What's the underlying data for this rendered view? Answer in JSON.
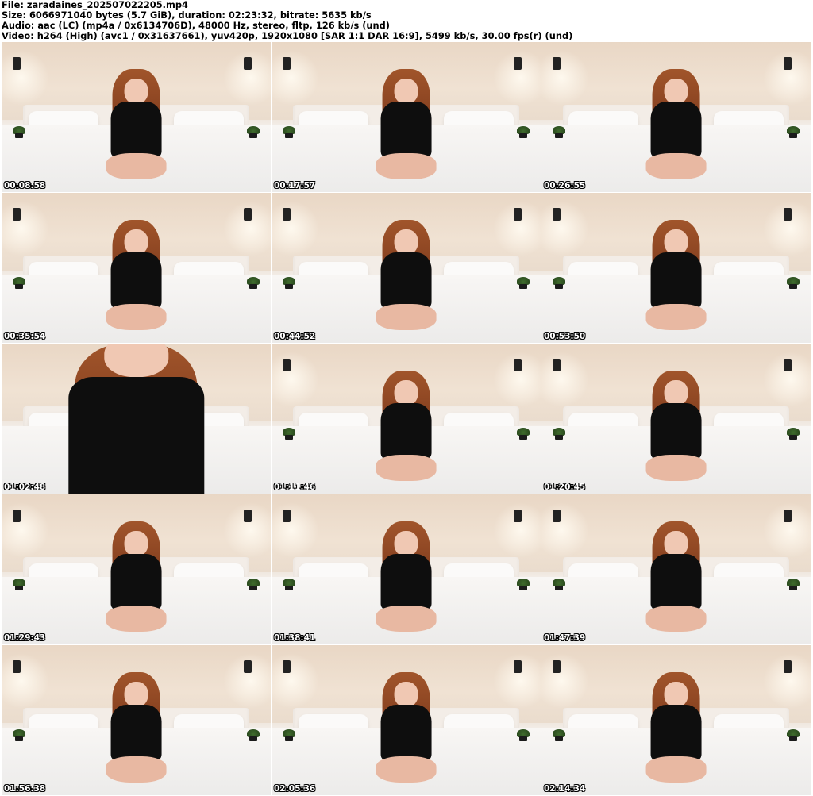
{
  "header": {
    "line1": "File: zaradaines_202507022205.mp4",
    "line2": "Size: 6066971040 bytes (5.7 GiB), duration: 02:23:32, bitrate: 5635 kb/s",
    "line3": "Audio: aac (LC) (mp4a / 0x6134706D), 48000 Hz, stereo, fltp, 126 kb/s (und)",
    "line4": "Video: h264 (High) (avc1 / 0x31637661), yuv420p, 1920x1080 [SAR 1:1 DAR 16:9], 5499 kb/s, 30.00 fps(r) (und)"
  },
  "thumbnails": [
    {
      "timestamp": "00:08:58"
    },
    {
      "timestamp": "00:17:57"
    },
    {
      "timestamp": "00:26:55"
    },
    {
      "timestamp": "00:35:54"
    },
    {
      "timestamp": "00:44:52"
    },
    {
      "timestamp": "00:53:50"
    },
    {
      "timestamp": "01:02:48"
    },
    {
      "timestamp": "01:11:46"
    },
    {
      "timestamp": "01:20:45"
    },
    {
      "timestamp": "01:29:43"
    },
    {
      "timestamp": "01:38:41"
    },
    {
      "timestamp": "01:47:39"
    },
    {
      "timestamp": "01:56:38"
    },
    {
      "timestamp": "02:05:36"
    },
    {
      "timestamp": "02:14:34"
    }
  ]
}
